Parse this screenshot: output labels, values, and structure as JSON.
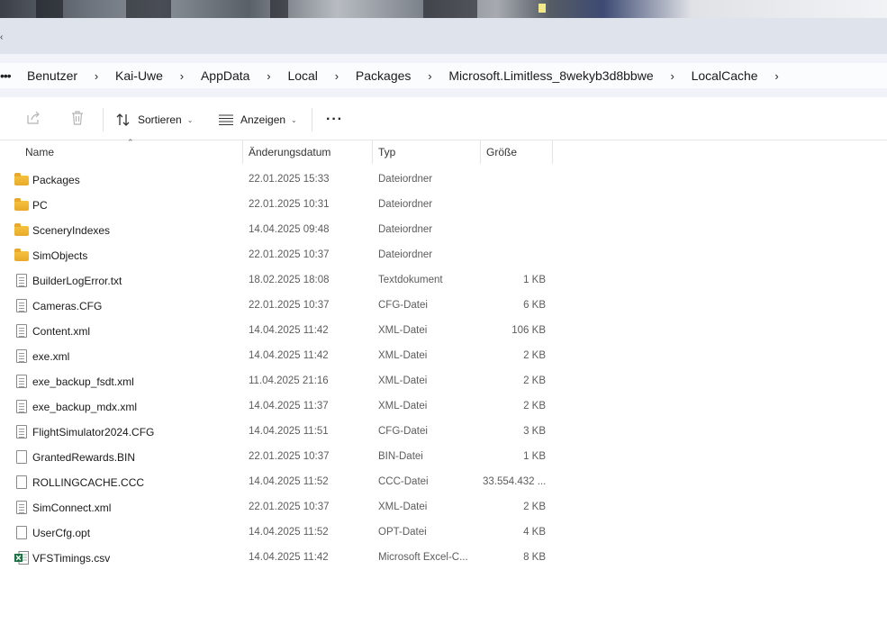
{
  "window": {
    "tab_edge_glyph": "‹"
  },
  "address": {
    "more": "•••",
    "crumbs": [
      "Benutzer",
      "Kai-Uwe",
      "AppData",
      "Local",
      "Packages",
      "Microsoft.Limitless_8wekyb3d8bbwe",
      "LocalCache"
    ],
    "separator": "›"
  },
  "toolbar": {
    "sort_label": "Sortieren",
    "view_label": "Anzeigen",
    "more_label": "···",
    "chevron": "⌄"
  },
  "columns": {
    "name": "Name",
    "date": "Änderungsdatum",
    "type": "Typ",
    "size": "Größe",
    "sort_indicator": "⌃"
  },
  "files": [
    {
      "name": "Packages",
      "date": "22.01.2025 15:33",
      "type": "Dateiordner",
      "size": "",
      "icon": "folder-icon"
    },
    {
      "name": "PC",
      "date": "22.01.2025 10:31",
      "type": "Dateiordner",
      "size": "",
      "icon": "folder-icon"
    },
    {
      "name": "SceneryIndexes",
      "date": "14.04.2025 09:48",
      "type": "Dateiordner",
      "size": "",
      "icon": "folder-icon"
    },
    {
      "name": "SimObjects",
      "date": "22.01.2025 10:37",
      "type": "Dateiordner",
      "size": "",
      "icon": "folder-icon"
    },
    {
      "name": "BuilderLogError.txt",
      "date": "18.02.2025 18:08",
      "type": "Textdokument",
      "size": "1 KB",
      "icon": "text-file-icon"
    },
    {
      "name": "Cameras.CFG",
      "date": "22.01.2025 10:37",
      "type": "CFG-Datei",
      "size": "6 KB",
      "icon": "text-file-icon"
    },
    {
      "name": "Content.xml",
      "date": "14.04.2025 11:42",
      "type": "XML-Datei",
      "size": "106 KB",
      "icon": "text-file-icon"
    },
    {
      "name": "exe.xml",
      "date": "14.04.2025 11:42",
      "type": "XML-Datei",
      "size": "2 KB",
      "icon": "text-file-icon"
    },
    {
      "name": "exe_backup_fsdt.xml",
      "date": "11.04.2025 21:16",
      "type": "XML-Datei",
      "size": "2 KB",
      "icon": "text-file-icon"
    },
    {
      "name": "exe_backup_mdx.xml",
      "date": "14.04.2025 11:37",
      "type": "XML-Datei",
      "size": "2 KB",
      "icon": "text-file-icon"
    },
    {
      "name": "FlightSimulator2024.CFG",
      "date": "14.04.2025 11:51",
      "type": "CFG-Datei",
      "size": "3 KB",
      "icon": "text-file-icon"
    },
    {
      "name": "GrantedRewards.BIN",
      "date": "22.01.2025 10:37",
      "type": "BIN-Datei",
      "size": "1 KB",
      "icon": "blank-file-icon"
    },
    {
      "name": "ROLLINGCACHE.CCC",
      "date": "14.04.2025 11:52",
      "type": "CCC-Datei",
      "size": "33.554.432 ...",
      "icon": "blank-file-icon"
    },
    {
      "name": "SimConnect.xml",
      "date": "22.01.2025 10:37",
      "type": "XML-Datei",
      "size": "2 KB",
      "icon": "text-file-icon"
    },
    {
      "name": "UserCfg.opt",
      "date": "14.04.2025 11:52",
      "type": "OPT-Datei",
      "size": "4 KB",
      "icon": "blank-file-icon"
    },
    {
      "name": "VFSTimings.csv",
      "date": "14.04.2025 11:42",
      "type": "Microsoft Excel-C...",
      "size": "8 KB",
      "icon": "excel-file-icon"
    }
  ],
  "colors": {
    "folder": "#f0b73a",
    "excel": "#1d7044",
    "addressbar_bg": "#f0f3f9",
    "tabstrip_bg": "#dfe3ec"
  }
}
